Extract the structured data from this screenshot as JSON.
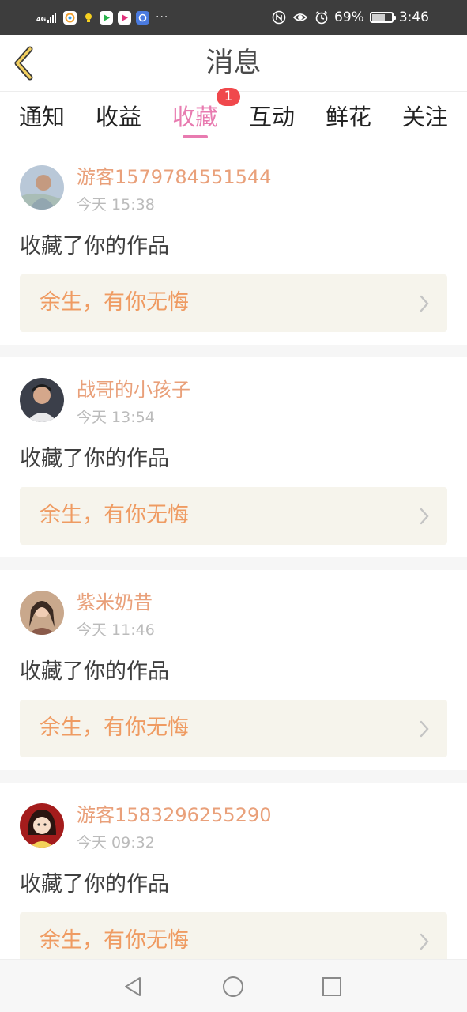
{
  "status_bar": {
    "network": "4G",
    "battery": "69%",
    "battery_level": 0.69,
    "time": "3:46",
    "overflow": "···",
    "icons": [
      "signal-icon",
      "app-icon-1",
      "app-icon-2",
      "app-icon-3",
      "app-icon-4",
      "app-icon-5",
      "nfc-icon",
      "eye-icon",
      "alarm-icon",
      "battery-icon"
    ]
  },
  "header": {
    "title": "消息",
    "back_icon": "back-chevron-icon"
  },
  "tabs": [
    {
      "label": "通知"
    },
    {
      "label": "收益"
    },
    {
      "label": "收藏",
      "badge": "1",
      "active": true
    },
    {
      "label": "互动"
    },
    {
      "label": "鲜花"
    },
    {
      "label": "关注"
    }
  ],
  "messages": [
    {
      "user": "游客1579784551544",
      "time": "今天 15:38",
      "action": "收藏了你的作品",
      "work": "余生，有你无悔"
    },
    {
      "user": "战哥的小孩子",
      "time": "今天 13:54",
      "action": "收藏了你的作品",
      "work": "余生，有你无悔"
    },
    {
      "user": "紫米奶昔",
      "time": "今天 11:46",
      "action": "收藏了你的作品",
      "work": "余生，有你无悔"
    },
    {
      "user": "游客1583296255290",
      "time": "今天 09:32",
      "action": "收藏了你的作品",
      "work": "余生，有你无悔"
    }
  ],
  "colors": {
    "accent": "#e87bb0",
    "username": "#e9a07a",
    "work_title": "#ef9b62",
    "badge": "#f0484c"
  }
}
